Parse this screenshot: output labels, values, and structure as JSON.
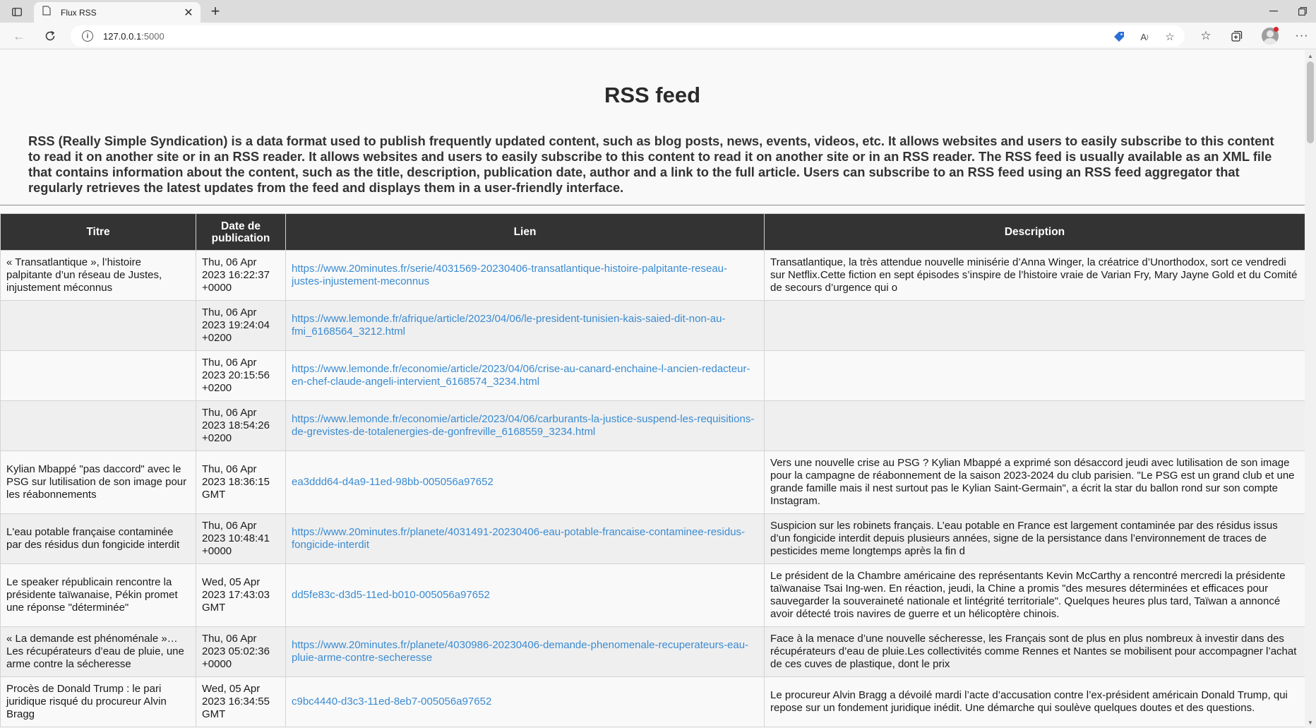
{
  "browser": {
    "tab_title": "Flux RSS",
    "url_host": "127.0.0.1",
    "url_port": ":5000"
  },
  "page": {
    "title": "RSS feed",
    "intro": "RSS (Really Simple Syndication) is a data format used to publish frequently updated content, such as blog posts, news, events, videos, etc. It allows websites and users to easily subscribe to this content to read it on another site or in an RSS reader. It allows websites and users to easily subscribe to this content to read it on another site or in an RSS reader. The RSS feed is usually available as an XML file that contains information about the content, such as the title, description, publication date, author and a link to the full article. Users can subscribe to an RSS feed using an RSS feed aggregator that regularly retrieves the latest updates from the feed and displays them in a user-friendly interface."
  },
  "table": {
    "headers": [
      "Titre",
      "Date de publication",
      "Lien",
      "Description"
    ],
    "rows": [
      {
        "title": "« Transatlantique », l’histoire palpitante d’un réseau de Justes, injustement méconnus",
        "date": "Thu, 06 Apr 2023 16:22:37 +0000",
        "link": "https://www.20minutes.fr/serie/4031569-20230406-transatlantique-histoire-palpitante-reseau-justes-injustement-meconnus",
        "description": "Transatlantique, la très attendue nouvelle minisérie d’Anna Winger, la créatrice d’Unorthodox, sort ce vendredi sur Netflix.Cette fiction en sept épisodes s’inspire de l’histoire vraie de Varian Fry, Mary Jayne Gold et du Comité de secours d’urgence qui o"
      },
      {
        "title": "",
        "date": "Thu, 06 Apr 2023 19:24:04 +0200",
        "link": "https://www.lemonde.fr/afrique/article/2023/04/06/le-president-tunisien-kais-saied-dit-non-au-fmi_6168564_3212.html",
        "description": ""
      },
      {
        "title": "",
        "date": "Thu, 06 Apr 2023 20:15:56 +0200",
        "link": "https://www.lemonde.fr/economie/article/2023/04/06/crise-au-canard-enchaine-l-ancien-redacteur-en-chef-claude-angeli-intervient_6168574_3234.html",
        "description": ""
      },
      {
        "title": "",
        "date": "Thu, 06 Apr 2023 18:54:26 +0200",
        "link": "https://www.lemonde.fr/economie/article/2023/04/06/carburants-la-justice-suspend-les-requisitions-de-grevistes-de-totalenergies-de-gonfreville_6168559_3234.html",
        "description": ""
      },
      {
        "title": "Kylian Mbappé \"pas daccord\" avec le PSG sur lutilisation de son image pour les réabonnements",
        "date": "Thu, 06 Apr 2023 18:36:15 GMT",
        "link": "ea3ddd64-d4a9-11ed-98bb-005056a97652",
        "description": "Vers une nouvelle crise au PSG ? Kylian Mbappé a exprimé son désaccord jeudi avec lutilisation de son image pour la campagne de réabonnement de la saison 2023-2024 du club parisien.  \"Le PSG est un grand club et une grande famille mais il nest surtout pas le Kylian Saint-Germain\", a écrit la star du ballon rond sur son compte Instagram."
      },
      {
        "title": "L'eau potable française contaminée par des résidus dun fongicide interdit",
        "date": "Thu, 06 Apr 2023 10:48:41 +0000",
        "link": "https://www.20minutes.fr/planete/4031491-20230406-eau-potable-francaise-contaminee-residus-fongicide-interdit",
        "description": "Suspicion sur les robinets français. L’eau potable en France est largement contaminée par des résidus issus d’un fongicide interdit depuis plusieurs années, signe de la persistance dans l’environnement de traces de pesticides meme longtemps après la fin d"
      },
      {
        "title": "Le speaker républicain rencontre la présidente taïwanaise, Pékin promet une réponse \"déterminée\"",
        "date": "Wed, 05 Apr 2023 17:43:03 GMT",
        "link": "dd5fe83c-d3d5-11ed-b010-005056a97652",
        "description": "Le président de la Chambre américaine des représentants Kevin McCarthy a rencontré mercredi la présidente taïwanaise Tsai Ing-wen. En réaction, jeudi, la Chine a promis \"des mesures déterminées et efficaces pour sauvegarder la souveraineté nationale et lintégrité territoriale\". Quelques heures plus tard, Taïwan a annoncé avoir détecté trois navires de guerre et un hélicoptère chinois."
      },
      {
        "title": "« La demande est phénoménale »… Les récupérateurs d’eau de pluie, une arme contre la sécheresse",
        "date": "Thu, 06 Apr 2023 05:02:36 +0000",
        "link": "https://www.20minutes.fr/planete/4030986-20230406-demande-phenomenale-recuperateurs-eau-pluie-arme-contre-secheresse",
        "description": "Face à la menace d’une nouvelle sécheresse, les Français sont de plus en plus nombreux à investir dans des récupérateurs d’eau de pluie.Les collectivités comme Rennes et Nantes se mobilisent pour accompagner l’achat de ces cuves de plastique, dont le prix"
      },
      {
        "title": "Procès de Donald Trump : le pari juridique risqué du procureur Alvin Bragg",
        "date": "Wed, 05 Apr 2023 16:34:55 GMT",
        "link": "c9bc4440-d3c3-11ed-8eb7-005056a97652",
        "description": "Le procureur Alvin Bragg a dévoilé mardi l’acte d’accusation contre l’ex-président américain Donald Trump, qui repose sur un fondement juridique inédit. Une démarche qui soulève quelques doutes et des questions."
      }
    ]
  }
}
